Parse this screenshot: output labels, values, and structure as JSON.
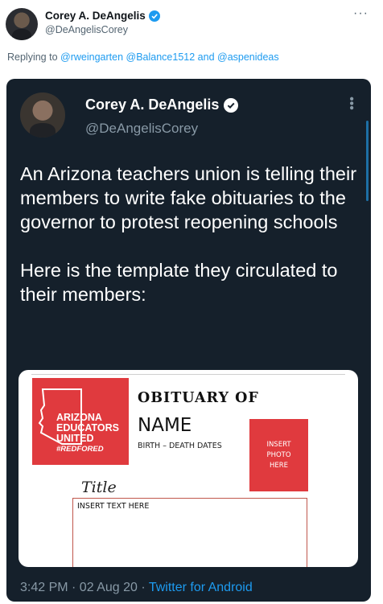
{
  "outer": {
    "name": "Corey A. DeAngelis",
    "handle": "@DeAngelisCorey",
    "more": "···",
    "replying_prefix": "Replying to ",
    "reply_user_1": "@rweingarten",
    "reply_user_2": "@Balance1512",
    "reply_and": " and ",
    "reply_user_3": "@aspenideas"
  },
  "inner": {
    "name": "Corey A. DeAngelis",
    "handle": "@DeAngelisCorey",
    "paragraph_1": "An Arizona teachers union is telling their members to write fake obituaries to the governor to protest reopening schools",
    "paragraph_2": "Here is the template they circulated to their members:",
    "time": "3:42 PM · 02 Aug 20 · ",
    "source": "Twitter for Android"
  },
  "obituary": {
    "logo_line_1": "ARIZONA",
    "logo_line_2": "EDUCATORS",
    "logo_line_3": "UNITED",
    "logo_line_4": "#REDFORED",
    "title": "OBITUARY OF",
    "name": "NAME",
    "dates": "BIRTH – DEATH DATES",
    "photo_line_1": "INSERT",
    "photo_line_2": "PHOTO",
    "photo_line_3": "HERE",
    "subtitle": "Title",
    "placeholder": "INSERT TEXT HERE"
  },
  "colors": {
    "brand_blue": "#1d9bf0",
    "dark_background": "#15202b",
    "union_red": "#e03a3e"
  },
  "icons": [
    "verified-badge-icon",
    "more-options-icon",
    "arizona-state-icon"
  ]
}
